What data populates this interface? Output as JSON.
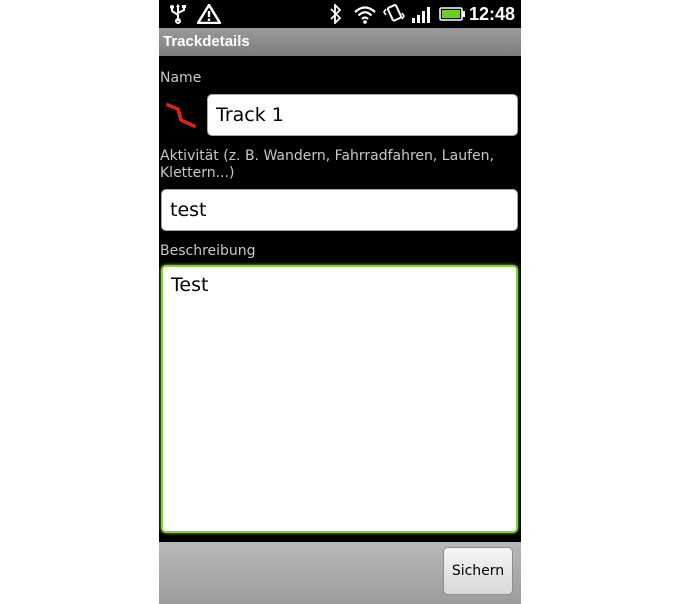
{
  "status_bar": {
    "time": "12:48",
    "icons": [
      "usb-icon",
      "warning-icon",
      "bluetooth-icon",
      "wifi-icon",
      "vibrate-icon",
      "signal-icon",
      "battery-icon"
    ],
    "battery_color": "#6ad21e"
  },
  "title_bar": {
    "title": "Trackdetails"
  },
  "form": {
    "name_label": "Name",
    "name_value": "Track 1",
    "activity_label": "Aktivität (z. B. Wandern, Fahrradfahren, Laufen, Klettern...)",
    "activity_value": "test",
    "description_label": "Beschreibung",
    "description_value": "Test"
  },
  "bottom_bar": {
    "save_label": "Sichern"
  },
  "colors": {
    "focus_border": "#8dcc3a",
    "track_icon": "#d8261c"
  }
}
